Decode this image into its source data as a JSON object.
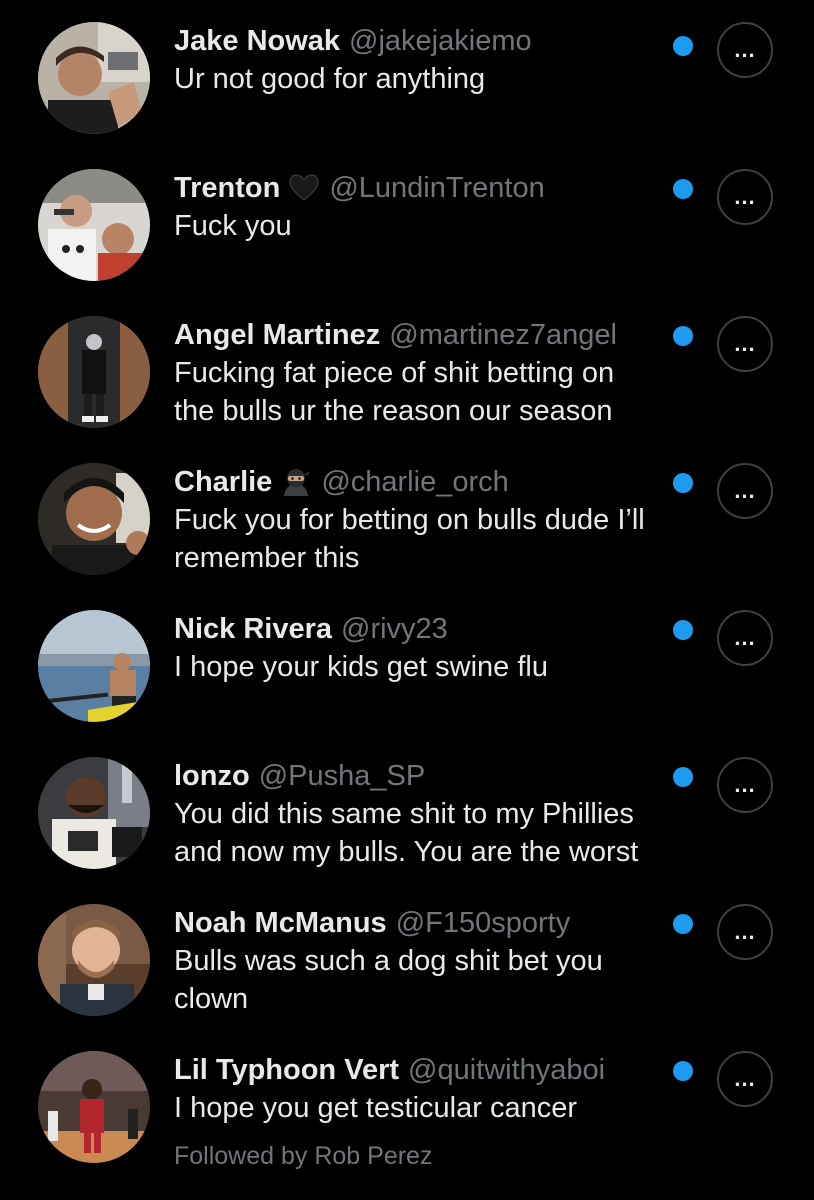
{
  "colors": {
    "background": "#000000",
    "primary_text": "#e7e9ea",
    "secondary_text": "#71767b",
    "unread_dot": "#1d9bf0",
    "button_border": "#3e4144"
  },
  "users": [
    {
      "name": "Jake Nowak",
      "handle": "@jakejakiemo",
      "text_lines": [
        "Ur not good for anything"
      ],
      "emoji": null,
      "followed_by": null,
      "more_label": "..."
    },
    {
      "name": "Trenton",
      "handle": "@LundinTrenton",
      "text_lines": [
        "Fuck you"
      ],
      "emoji": "black-heart-icon",
      "followed_by": null,
      "more_label": "..."
    },
    {
      "name": "Angel Martinez",
      "handle": "@martinez7angel",
      "text_lines": [
        "Fucking fat piece of shit betting on",
        "the bulls ur the reason our season"
      ],
      "emoji": null,
      "followed_by": null,
      "more_label": "..."
    },
    {
      "name": "Charlie",
      "handle": "@charlie_orch",
      "text_lines": [
        "Fuck you for betting on bulls dude I’ll",
        "remember this"
      ],
      "emoji": "ninja-icon",
      "followed_by": null,
      "more_label": "..."
    },
    {
      "name": "Nick Rivera",
      "handle": "@rivy23",
      "text_lines": [
        "I hope your kids get swine flu"
      ],
      "emoji": null,
      "followed_by": null,
      "more_label": "..."
    },
    {
      "name": "lonzo",
      "handle": "@Pusha_SP",
      "text_lines": [
        "You did this same shit to my Phillies",
        "and now my bulls. You are the worst"
      ],
      "emoji": null,
      "followed_by": null,
      "more_label": "..."
    },
    {
      "name": "Noah McManus",
      "handle": "@F150sporty",
      "text_lines": [
        "Bulls was such a dog shit bet you",
        "clown"
      ],
      "emoji": null,
      "followed_by": null,
      "more_label": "..."
    },
    {
      "name": "Lil Typhoon Vert",
      "handle": "@quitwithyaboi",
      "text_lines": [
        "I hope you get testicular cancer"
      ],
      "emoji": null,
      "followed_by": "Followed by Rob Perez",
      "more_label": "..."
    }
  ]
}
